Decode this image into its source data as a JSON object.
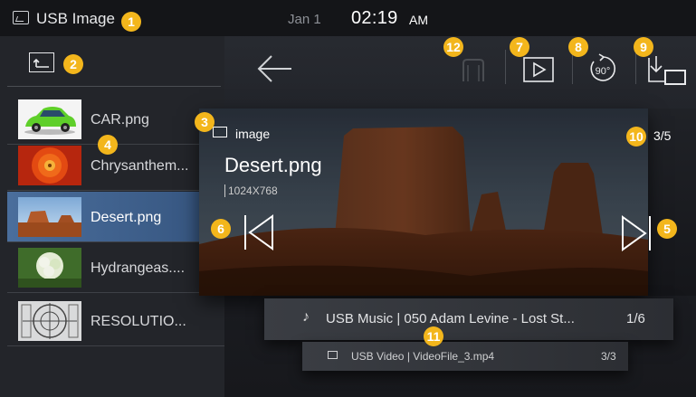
{
  "status_bar": {
    "source": "USB Image",
    "date": "Jan 1",
    "time": "02:19",
    "ampm": "AM"
  },
  "badges": [
    "1",
    "2",
    "3",
    "4",
    "5",
    "6",
    "7",
    "8",
    "9",
    "10",
    "11",
    "12"
  ],
  "sidebar": {
    "items": [
      {
        "label": "CAR.png"
      },
      {
        "label": "Chrysanthem..."
      },
      {
        "label": "Desert.png",
        "selected": true
      },
      {
        "label": "Hydrangeas...."
      },
      {
        "label": "RESOLUTIO..."
      }
    ]
  },
  "toolbar": {
    "rotate_label": "90°"
  },
  "viewer": {
    "folder": "image",
    "title": "Desert.png",
    "dimensions": "1024X768",
    "counter": "3/5"
  },
  "music": {
    "text": "USB Music  |  050 Adam Levine - Lost St...",
    "count": "1/6"
  },
  "video": {
    "text": "USB Video  |  VideoFile_3.mp4",
    "count": "3/3"
  },
  "colors": {
    "badge": "#f3b61c",
    "selected": "#4a6e9c",
    "background": "#1b1d22"
  }
}
